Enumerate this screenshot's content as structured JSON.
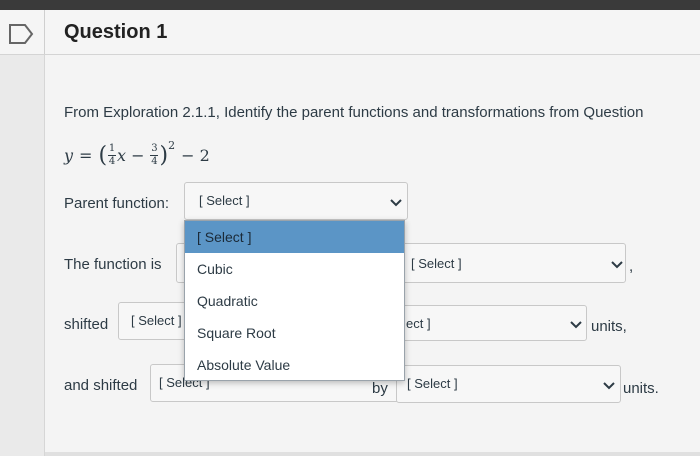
{
  "question": {
    "title": "Question 1"
  },
  "prompt": "From Exploration 2.1.1, Identify the parent functions and transformations from Question",
  "equation": {
    "lhs": "y",
    "equals": "=",
    "frac1_num": "1",
    "frac1_den": "4",
    "var": "x",
    "minus": "−",
    "frac2_num": "3",
    "frac2_den": "4",
    "exponent": "2",
    "tail": "− 2"
  },
  "rows": {
    "parent_label": "Parent function:",
    "parent_select": "[ Select ]",
    "function_is_label": "The function is",
    "function_is_select": "[ Select ]",
    "function_is_trailing": ",",
    "shifted_label": "shifted",
    "shifted_select_1": "[ Select ]",
    "shifted_select_2": "ect ]",
    "shifted_units": "units,",
    "and_shifted_label": "and shifted",
    "and_shifted_select_1": "[ Select ]",
    "by_label": "by",
    "and_shifted_select_2": "[ Select ]",
    "and_shifted_units": "units."
  },
  "dropdown": {
    "options": [
      "[ Select ]",
      "Cubic",
      "Quadratic",
      "Square Root",
      "Absolute Value"
    ],
    "highlighted_index": 0,
    "highlight_color": "#5b95c6"
  },
  "colors": {
    "text": "#2d3b45",
    "accent": "#5b95c6"
  }
}
